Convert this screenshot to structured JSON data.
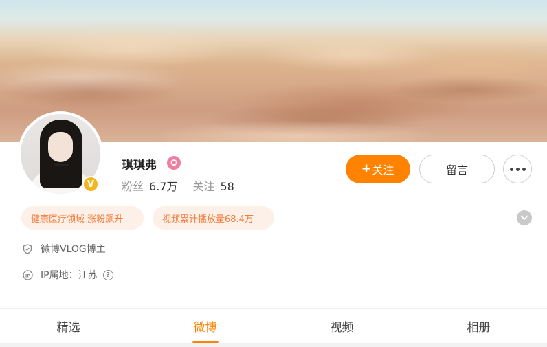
{
  "profile": {
    "name": "琪琪弗",
    "followers_label": "粉丝",
    "followers_value": "6.7万",
    "following_label": "关注",
    "following_value": "58",
    "verified_mark": "V"
  },
  "actions": {
    "follow_plus": "+",
    "follow_label": "关注",
    "message_label": "留言"
  },
  "tags": [
    {
      "label": "健康医疗领域 涨粉飙升"
    },
    {
      "label": "视频累计播放量68.4万"
    }
  ],
  "info": {
    "role": "微博VLOG博主",
    "ip_location": "IP属地：江苏",
    "help_glyph": "?"
  },
  "tabs": [
    {
      "label": "精选",
      "active": false
    },
    {
      "label": "微博",
      "active": true
    },
    {
      "label": "视频",
      "active": false
    },
    {
      "label": "相册",
      "active": false
    }
  ],
  "colors": {
    "accent": "#ff8200",
    "tag_text": "#f57b38",
    "tag_bg": "#fdf0e8",
    "verified_badge": "#f5b51c",
    "vip_icon": "#f07ea0"
  },
  "icons": {
    "verified": "verified-v-icon",
    "vip": "vip-badge-icon",
    "more": "more-dots-icon",
    "expand": "chevron-down-icon",
    "role": "shield-icon",
    "ip": "ip-icon",
    "help": "question-icon"
  }
}
